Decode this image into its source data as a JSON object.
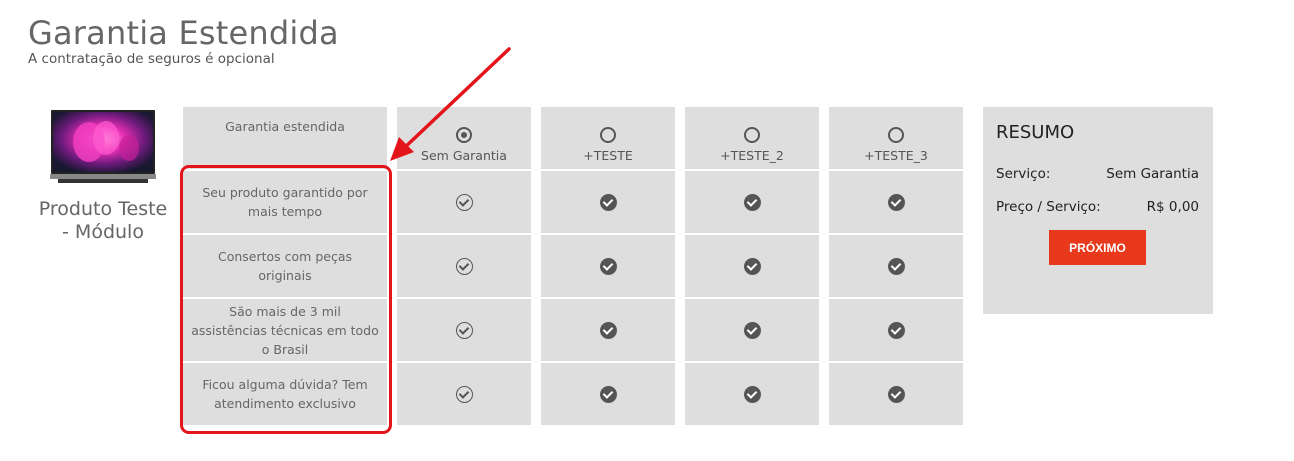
{
  "page": {
    "title": "Garantia Estendida",
    "subtitle": "A contratação de seguros é opcional"
  },
  "product": {
    "name": "Produto Teste - Módulo",
    "image_icon": "tv-product-image"
  },
  "table": {
    "feature_header": "Garantia estendida",
    "features": [
      "Seu produto garantido por mais tempo",
      "Consertos com peças originais",
      "São mais de 3 mil assistências técnicas em todo o Brasil",
      "Ficou alguma dúvida? Tem atendimento exclusivo"
    ],
    "options": [
      {
        "label": "Sem Garantia",
        "selected": true
      },
      {
        "label": "+TESTE",
        "selected": false
      },
      {
        "label": "+TESTE_2",
        "selected": false
      },
      {
        "label": "+TESTE_3",
        "selected": false
      }
    ],
    "check_icon": "check-circle-icon"
  },
  "summary": {
    "title": "RESUMO",
    "service_label": "Serviço:",
    "service_value": "Sem Garantia",
    "price_label": "Preço / Serviço:",
    "price_value": "R$ 0,00",
    "next_button": "PRÓXIMO"
  },
  "colors": {
    "cell_background": "#dedede",
    "highlight": "#e3141a",
    "button": "#e8391c"
  }
}
